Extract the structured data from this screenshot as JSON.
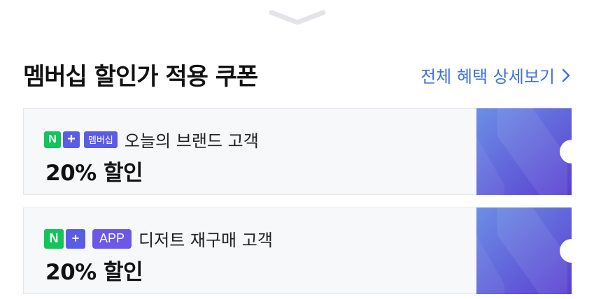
{
  "header": {
    "title": "멤버십 할인가 적용 쿠폰",
    "benefit_link": "전체 혜택 상세보기"
  },
  "coupons": [
    {
      "badges": [
        "N",
        "+",
        "멤버십"
      ],
      "condition": "오늘의 브랜드 고객",
      "discount": "20% 할인"
    },
    {
      "badges": [
        "N",
        "+",
        "APP"
      ],
      "condition": "디저트 재구매 고객",
      "discount": "20% 할인"
    }
  ],
  "colors": {
    "link": "#3f72d8",
    "naver_green": "#12c45a",
    "membership_purple": "#5b5ce6",
    "app_purple": "#6c57e8",
    "coupon_gradient_start": "#6b8fe6",
    "coupon_gradient_end": "#5a3fd0"
  },
  "icons": {
    "drag_handle": "chevron-down-icon",
    "link_arrow": "chevron-right-icon",
    "coupon_decoration": "n-logo-pattern"
  }
}
